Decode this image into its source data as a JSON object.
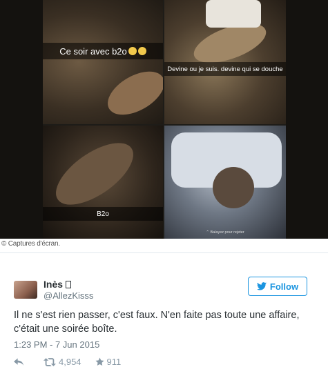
{
  "photos": {
    "caption_1": "Ce soir avec b2o",
    "caption_2": "Devine ou je suis. devine qui se douche",
    "caption_3": "B2o",
    "swipe_hint": "⌃ Balayez pour rejeter",
    "credit": "© Captures d'écran."
  },
  "tweet": {
    "name": "Inès",
    "handle": "@AllezKisss",
    "follow_label": "Follow",
    "text": "Il ne s'est rien passer, c'est faux. N'en faite pas toute une affaire, c'était une soirée boîte.",
    "timestamp": "1:23 PM - 7 Jun 2015",
    "retweets": "4,954",
    "likes": "911",
    "accent_color": "#1b95e0"
  }
}
